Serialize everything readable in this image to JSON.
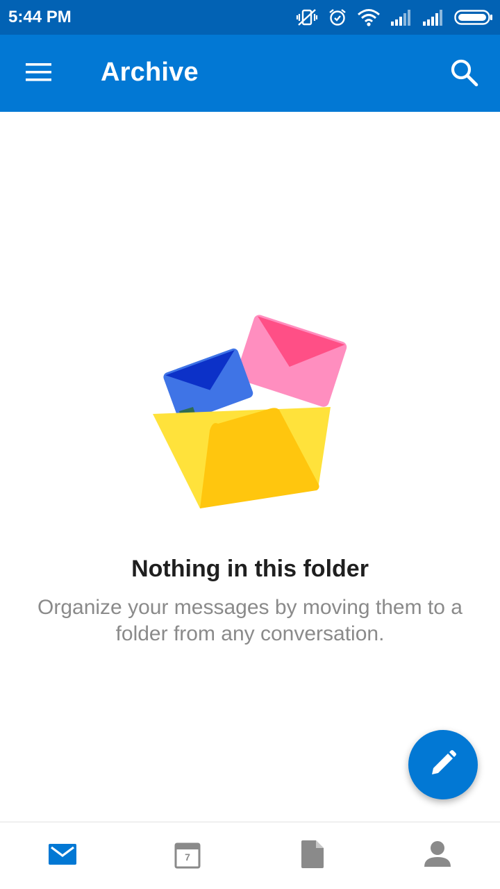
{
  "status_bar": {
    "time": "5:44 PM",
    "icons": [
      "vibrate-off-icon",
      "alarm-icon",
      "wifi-icon",
      "signal-icon",
      "signal-icon",
      "battery-icon"
    ]
  },
  "app_bar": {
    "title": "Archive",
    "menu_icon": "hamburger-menu-icon",
    "search_icon": "search-icon"
  },
  "empty_state": {
    "illustration": "folder-with-envelopes-illustration",
    "title": "Nothing in this folder",
    "description": "Organize your messages by moving them to a folder from any conversation."
  },
  "fab": {
    "icon": "pencil-compose-icon"
  },
  "bottom_nav": {
    "items": [
      {
        "name": "mail",
        "icon": "mail-icon",
        "active": true
      },
      {
        "name": "calendar",
        "icon": "calendar-icon",
        "day": "7",
        "active": false
      },
      {
        "name": "files",
        "icon": "file-icon",
        "active": false
      },
      {
        "name": "people",
        "icon": "person-icon",
        "active": false
      }
    ]
  },
  "colors": {
    "status_bar": "#0262b4",
    "app_bar": "#0278d4",
    "accent": "#0278d4",
    "inactive_icon": "#8a8a8a"
  }
}
